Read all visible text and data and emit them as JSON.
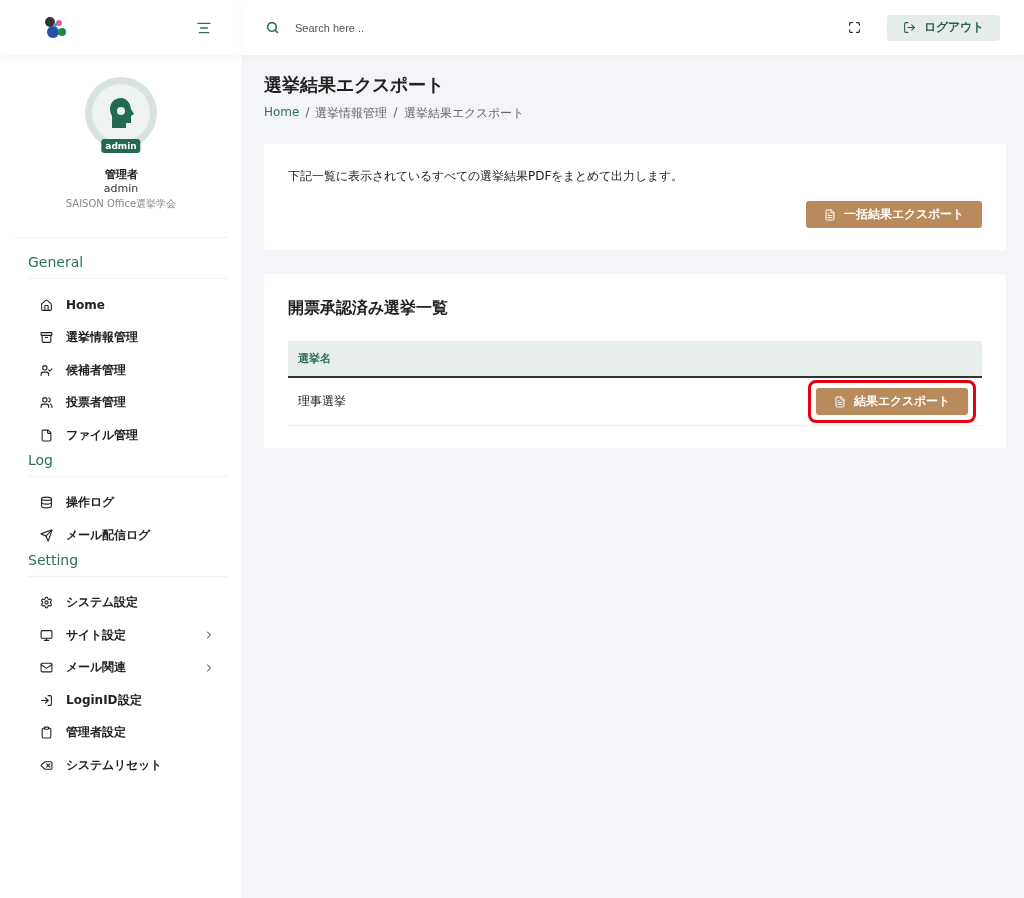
{
  "header": {
    "search": {
      "placeholder": "Search here .."
    },
    "logout_button": "ログアウト"
  },
  "profile": {
    "badge": "admin",
    "role": "管理者",
    "username": "admin",
    "organization": "SAISON Office選挙学会"
  },
  "sidebar": {
    "sections": [
      {
        "title": "General",
        "items": [
          {
            "label": "Home",
            "has_submenu": false
          },
          {
            "label": "選挙情報管理",
            "has_submenu": false
          },
          {
            "label": "候補者管理",
            "has_submenu": false
          },
          {
            "label": "投票者管理",
            "has_submenu": false
          },
          {
            "label": "ファイル管理",
            "has_submenu": false
          }
        ]
      },
      {
        "title": "Log",
        "items": [
          {
            "label": "操作ログ",
            "has_submenu": false
          },
          {
            "label": "メール配信ログ",
            "has_submenu": false
          }
        ]
      },
      {
        "title": "Setting",
        "items": [
          {
            "label": "システム設定",
            "has_submenu": false
          },
          {
            "label": "サイト設定",
            "has_submenu": true
          },
          {
            "label": "メール関連",
            "has_submenu": true
          },
          {
            "label": "LoginID設定",
            "has_submenu": false
          },
          {
            "label": "管理者設定",
            "has_submenu": false
          },
          {
            "label": "システムリセット",
            "has_submenu": false
          }
        ]
      }
    ]
  },
  "page": {
    "title": "選挙結果エクスポート",
    "breadcrumb_separator": "/",
    "breadcrumb": [
      "Home",
      "選挙情報管理",
      "選挙結果エクスポート"
    ]
  },
  "bulk_card": {
    "description": "下記一覧に表示されているすべての選挙結果PDFをまとめて出力します。",
    "button": "一括結果エクスポート"
  },
  "list_card": {
    "title": "開票承認済み選挙一覧",
    "table": {
      "columns": [
        "選挙名"
      ],
      "rows": [
        {
          "name": "理事選挙",
          "button": "結果エクスポート",
          "highlighted": true
        }
      ]
    }
  }
}
